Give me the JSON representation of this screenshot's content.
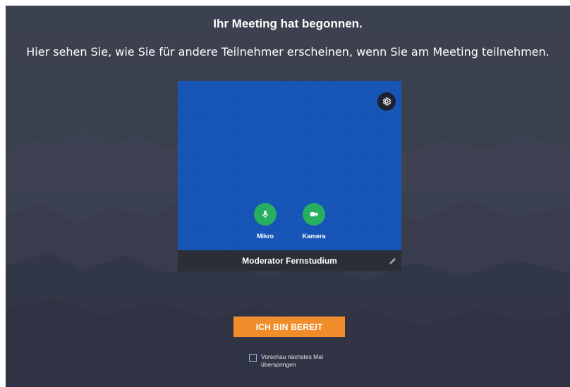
{
  "page": {
    "headline": "Ihr Meeting hat begonnen.",
    "subline": "Hier sehen Sie, wie Sie für andere Teilnehmer erscheinen, wenn Sie am Meeting teilnehmen."
  },
  "preview": {
    "settings_icon": "gear-icon",
    "controls": [
      {
        "label": "Mikro",
        "icon": "microphone-icon"
      },
      {
        "label": "Kamera",
        "icon": "camera-icon"
      }
    ],
    "participant_name": "Moderator Fernstudium",
    "edit_icon": "pencil-icon"
  },
  "actions": {
    "ready_label": "ICH BIN BEREIT",
    "skip_label_line1": "Vorschau nächstes Mal",
    "skip_label_line2": "überspringen",
    "skip_checked": false
  },
  "colors": {
    "background": "#3c4150",
    "preview_bg": "#1452b6",
    "control_green": "#27ae60",
    "ready_orange": "#f08c2a",
    "namebar": "#2b2e36"
  }
}
